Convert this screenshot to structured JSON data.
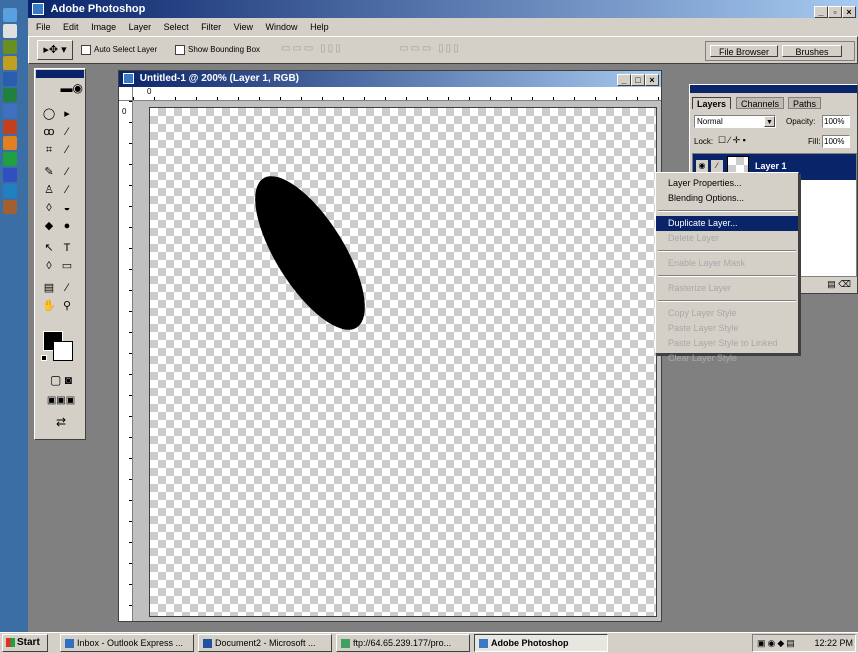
{
  "app": {
    "title": "Adobe Photoshop",
    "menu": [
      "File",
      "Edit",
      "Image",
      "Layer",
      "Select",
      "Filter",
      "View",
      "Window",
      "Help"
    ]
  },
  "options_bar": {
    "auto_select": "Auto Select Layer",
    "show_bounding": "Show Bounding Box",
    "file_browser": "File Browser",
    "brushes": "Brushes"
  },
  "document": {
    "title": "Untitled-1 @ 200% (Layer 1, RGB)",
    "ruler_zero": "0",
    "ellipse_color": "#000000"
  },
  "layers_panel": {
    "tabs": [
      "Layers",
      "Channels",
      "Paths"
    ],
    "blend_mode": "Normal",
    "opacity_label": "Opacity:",
    "opacity_value": "100%",
    "lock_label": "Lock:",
    "fill_label": "Fill:",
    "fill_value": "100%",
    "layer_name": "Layer 1"
  },
  "context_menu": {
    "items": [
      {
        "label": "Layer Properties...",
        "state": "enabled"
      },
      {
        "label": "Blending Options...",
        "state": "enabled"
      },
      {
        "label": "Duplicate Layer...",
        "state": "active"
      },
      {
        "label": "Delete Layer",
        "state": "disabled"
      },
      {
        "label": "Enable Layer Mask",
        "state": "disabled"
      },
      {
        "label": "Rasterize Layer",
        "state": "disabled"
      },
      {
        "label": "Copy Layer Style",
        "state": "disabled"
      },
      {
        "label": "Paste Layer Style",
        "state": "disabled"
      },
      {
        "label": "Paste Layer Style to Linked",
        "state": "disabled"
      },
      {
        "label": "Clear Layer Style",
        "state": "disabled"
      }
    ]
  },
  "taskbar": {
    "start": "Start",
    "buttons": [
      "Inbox - Outlook Express ...",
      "Document2 - Microsoft ...",
      "ftp://64.65.239.177/pro...",
      "Adobe Photoshop"
    ],
    "time": "12:22 PM"
  }
}
